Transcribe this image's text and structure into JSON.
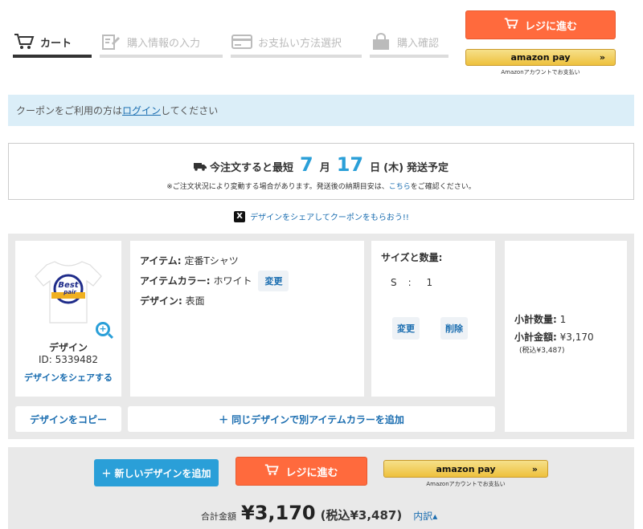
{
  "steps": [
    {
      "label": "カート",
      "icon": "cart-icon",
      "active": true
    },
    {
      "label": "購入情報の入力",
      "icon": "edit-form-icon",
      "active": false
    },
    {
      "label": "お支払い方法選択",
      "icon": "credit-card-icon",
      "active": false
    },
    {
      "label": "購入確認",
      "icon": "shopping-bag-icon",
      "active": false
    }
  ],
  "checkout_label": "レジに進む",
  "amazon_pay": {
    "logo": "amazon pay",
    "note": "Amazonアカウントでお支払い",
    "arrow": "»"
  },
  "coupon": {
    "pre": "クーポンをご利用の方は",
    "link": "ログイン",
    "post": "してください"
  },
  "shipping": {
    "pre": "今注文すると最短",
    "month": "7",
    "month_unit": "月",
    "day": "17",
    "day_unit": "日",
    "weekday": "(木)",
    "post": "発送予定",
    "note_pre": "※ご注文状況により変動する場合があります。発送後の納期目安は、",
    "note_link": "こちら",
    "note_post": "をご確認ください。"
  },
  "share_coupon": {
    "icon": "x-icon",
    "text": "デザインをシェアしてクーポンをもらおう!!",
    "x_glyph": "X"
  },
  "cart_item": {
    "design_label": "デザイン",
    "design_id": "ID: 5339482",
    "share_label": "デザインをシェアする",
    "item_key": "アイテム:",
    "item_value": "定番Tシャツ",
    "color_key": "アイテムカラー:",
    "color_value": "ホワイト",
    "change_label": "変更",
    "design_key": "デザイン:",
    "design_value": "表面",
    "size_title": "サイズと数量:",
    "size_value": "S　:　 1",
    "size_change": "変更",
    "delete_label": "削除",
    "qty_key": "小計数量:",
    "qty_value": "1",
    "amount_key": "小計金額:",
    "amount_value": "¥3,170",
    "tax_note": "(税込¥3,487)",
    "copy_label": "デザインをコピー",
    "add_color_label": "同じデザインで別アイテムカラーを追加",
    "shirt_text1": "Best",
    "shirt_text2": "pair"
  },
  "bottom": {
    "new_design_label": "新しいデザインを追加",
    "total_label": "合計金額",
    "total_amount": "¥3,170",
    "total_tax": "(税込¥3,487)",
    "breakdown": "内訳▴"
  },
  "colors": {
    "accent_blue": "#2a9fd8",
    "checkout_orange": "#ff6a3d",
    "link_blue": "#1a6db0"
  }
}
